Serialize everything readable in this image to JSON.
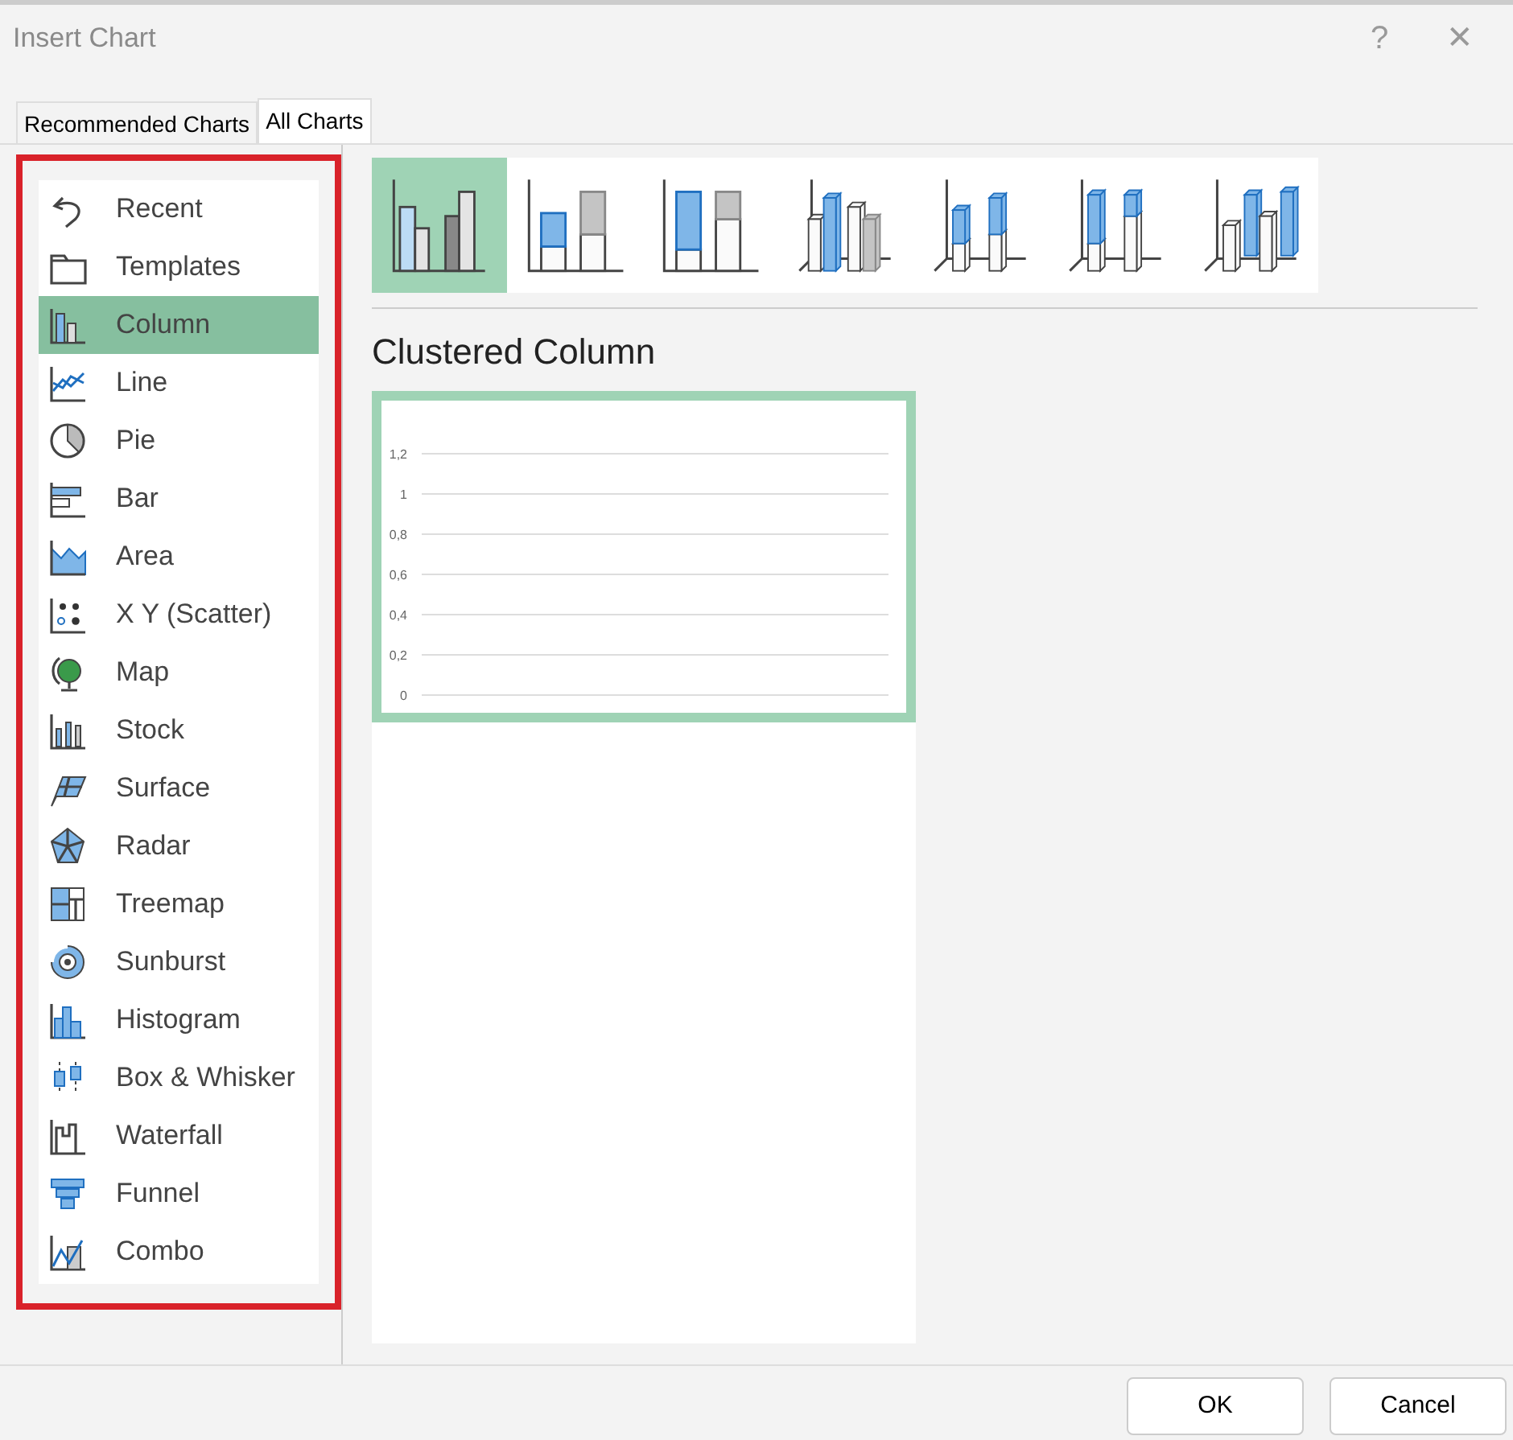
{
  "window": {
    "title": "Insert Chart",
    "help": "?",
    "close": "✕"
  },
  "tabs": [
    {
      "label": "Recommended Charts",
      "selected": false
    },
    {
      "label": "All Charts",
      "selected": true
    }
  ],
  "chart_types": [
    {
      "label": "Recent",
      "selected": false
    },
    {
      "label": "Templates",
      "selected": false
    },
    {
      "label": "Column",
      "selected": true
    },
    {
      "label": "Line",
      "selected": false
    },
    {
      "label": "Pie",
      "selected": false
    },
    {
      "label": "Bar",
      "selected": false
    },
    {
      "label": "Area",
      "selected": false
    },
    {
      "label": "X Y (Scatter)",
      "selected": false
    },
    {
      "label": "Map",
      "selected": false
    },
    {
      "label": "Stock",
      "selected": false
    },
    {
      "label": "Surface",
      "selected": false
    },
    {
      "label": "Radar",
      "selected": false
    },
    {
      "label": "Treemap",
      "selected": false
    },
    {
      "label": "Sunburst",
      "selected": false
    },
    {
      "label": "Histogram",
      "selected": false
    },
    {
      "label": "Box & Whisker",
      "selected": false
    },
    {
      "label": "Waterfall",
      "selected": false
    },
    {
      "label": "Funnel",
      "selected": false
    },
    {
      "label": "Combo",
      "selected": false
    }
  ],
  "subtypes": [
    {
      "selected": true
    },
    {
      "selected": false
    },
    {
      "selected": false
    },
    {
      "selected": false
    },
    {
      "selected": false
    },
    {
      "selected": false
    },
    {
      "selected": false
    }
  ],
  "subtype_title": "Clustered Column",
  "preview": {
    "chart_data": {
      "type": "bar",
      "categories": [
        null
      ],
      "values": [
        null
      ],
      "grid": true,
      "ylim": [
        0,
        1.2
      ],
      "yticks": [
        {
          "value": 0,
          "label": "0"
        },
        {
          "value": 0.2,
          "label": "0,2"
        },
        {
          "value": 0.4,
          "label": "0,4"
        },
        {
          "value": 0.6,
          "label": "0,6"
        },
        {
          "value": 0.8,
          "label": "0,8"
        },
        {
          "value": 1,
          "label": "1"
        },
        {
          "value": 1.2,
          "label": "1,2"
        }
      ]
    }
  },
  "buttons": [
    {
      "label": "OK"
    },
    {
      "label": "Cancel"
    }
  ]
}
